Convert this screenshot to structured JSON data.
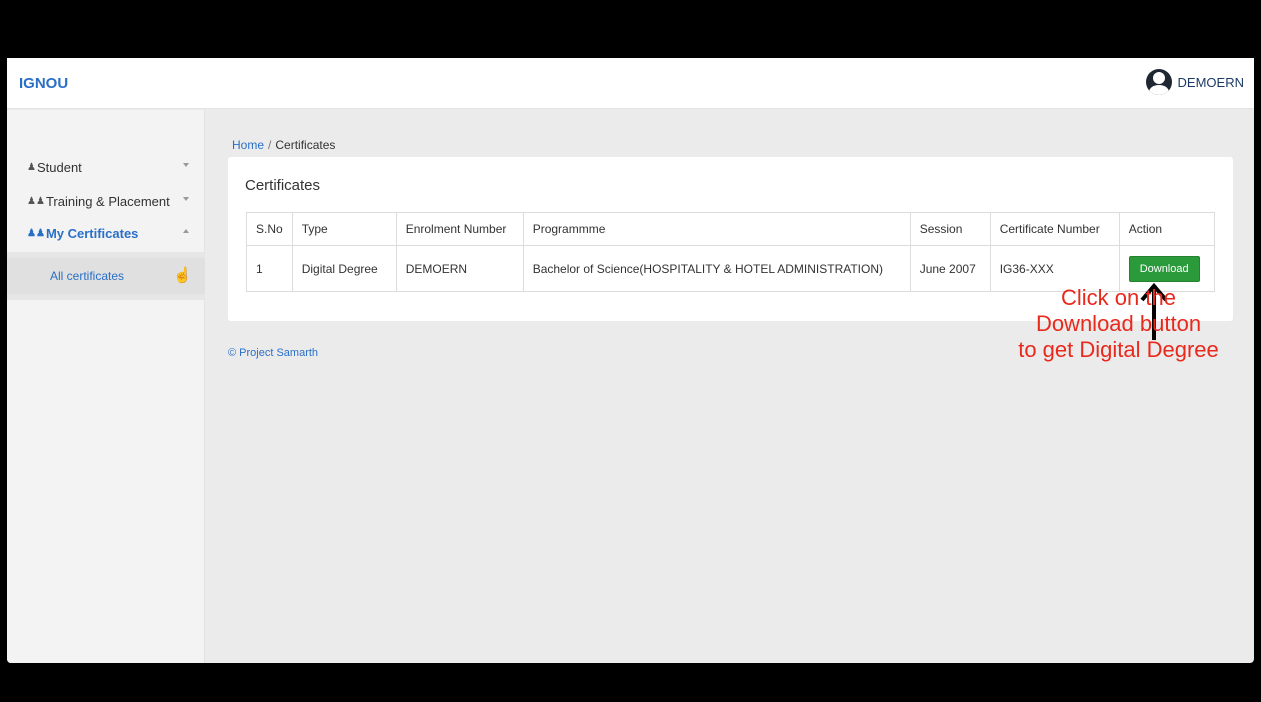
{
  "header": {
    "brand": "IGNOU",
    "user_name": "DEMOERN"
  },
  "sidebar": {
    "items": [
      {
        "label": "Student",
        "icon": "user-icon",
        "expanded": false
      },
      {
        "label": "Training & Placement",
        "icon": "users-icon",
        "expanded": false
      },
      {
        "label": "My Certificates",
        "icon": "users-icon",
        "expanded": true
      }
    ],
    "sub_items": [
      {
        "label": "All certificates"
      }
    ]
  },
  "breadcrumb": {
    "home": "Home",
    "separator": "/",
    "current": "Certificates"
  },
  "card": {
    "title": "Certificates"
  },
  "table": {
    "headers": [
      "S.No",
      "Type",
      "Enrolment Number",
      "Programmme",
      "Session",
      "Certificate Number",
      "Action"
    ],
    "rows": [
      {
        "sno": "1",
        "type": "Digital Degree",
        "enrolment": "DEMOERN",
        "programme": "Bachelor of Science(HOSPITALITY & HOTEL ADMINISTRATION)",
        "session": "June 2007",
        "certificate": "IG36-XXX",
        "action": "Download"
      }
    ]
  },
  "footer": {
    "text": "© Project Samarth"
  },
  "annotation": {
    "lines": [
      "Click on the",
      "Download button",
      "to get Digital Degree"
    ],
    "color": "#e8291c"
  },
  "colors": {
    "brand": "#2a6fc7",
    "download_button": "#2a9a3a"
  }
}
